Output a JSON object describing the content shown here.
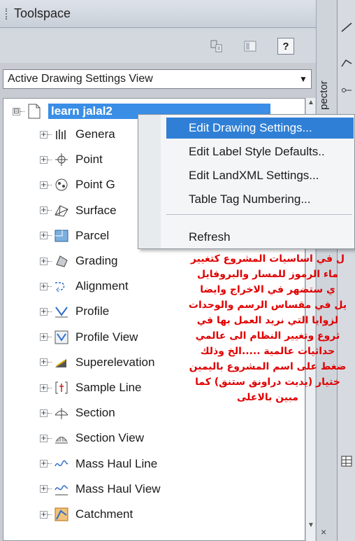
{
  "panel": {
    "title": "Toolspace",
    "dropdown_value": "Active Drawing Settings View",
    "side_tab": "pector",
    "close_glyph": "×"
  },
  "tree": {
    "root": {
      "label": "learn jalal2",
      "expander": "⊟"
    },
    "items": [
      {
        "label": "Genera",
        "icon": "general-icon"
      },
      {
        "label": "Point",
        "icon": "point-icon"
      },
      {
        "label": "Point G",
        "icon": "point-group-icon"
      },
      {
        "label": "Surface",
        "icon": "surface-icon"
      },
      {
        "label": "Parcel",
        "icon": "parcel-icon"
      },
      {
        "label": "Grading",
        "icon": "grading-icon"
      },
      {
        "label": "Alignment",
        "icon": "alignment-icon"
      },
      {
        "label": "Profile",
        "icon": "profile-icon"
      },
      {
        "label": "Profile View",
        "icon": "profile-view-icon"
      },
      {
        "label": "Superelevation",
        "icon": "superelevation-icon"
      },
      {
        "label": "Sample Line",
        "icon": "sample-line-icon"
      },
      {
        "label": "Section",
        "icon": "section-icon"
      },
      {
        "label": "Section View",
        "icon": "section-view-icon"
      },
      {
        "label": "Mass Haul Line",
        "icon": "mass-haul-line-icon"
      },
      {
        "label": "Mass Haul View",
        "icon": "mass-haul-view-icon"
      },
      {
        "label": "Catchment",
        "icon": "catchment-icon"
      }
    ]
  },
  "context_menu": {
    "items": [
      "Edit Drawing Settings...",
      "Edit Label Style Defaults..",
      "Edit LandXML Settings...",
      "Table Tag Numbering...",
      "Refresh"
    ],
    "highlighted_index": 0
  },
  "annotation": {
    "lines": [
      "ل في اساسيات المشروع كتغيير",
      "ماء الرموز للمسار والبروفايل",
      "ي ستضهر في الاخراج وايضا",
      "يل في مقساس الرسم والوحدات",
      "لزوايا التي نريد العمل بها في",
      "ثروع وتغيير النظام الى عالمي",
      "حداثيات عالمية .....الخ وذلك",
      "ضغط على اسم المشروع باليمين",
      "ختيار (يديت دراونق ستنق) كما",
      "مبين بالاعلى"
    ],
    "color": "#e00000"
  },
  "colors": {
    "selection": "#2f7fd6",
    "accent_red": "#e00000"
  }
}
